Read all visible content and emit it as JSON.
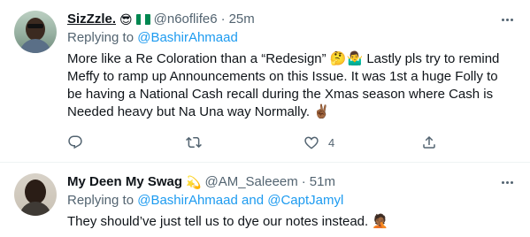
{
  "tweets": [
    {
      "name": "SizZzle.",
      "name_emoji": "😎",
      "flag_colors": [
        "#008751",
        "#ffffff",
        "#008751"
      ],
      "handle": "@n6oflife6",
      "separator": "·",
      "time": "25m",
      "replying_prefix": "Replying to ",
      "replying_to": [
        "@BashirAhmaad"
      ],
      "text": "More like a Re Coloration than a “Redesign” 🤔🤷‍♂️ Lastly pls try to remind Meffy to ramp up Announcements on this Issue. It was 1st a huge Folly to be having a National Cash recall during the Xmas season where Cash is Needed heavy but Na Una way Normally. ✌🏾",
      "actions": {
        "reply_count": "",
        "retweet_count": "",
        "like_count": "4"
      }
    },
    {
      "name": "My Deen My Swag",
      "name_emoji": "💫",
      "handle": "@AM_Saleeem",
      "separator": "·",
      "time": "51m",
      "replying_prefix": "Replying to ",
      "replying_to": [
        "@BashirAhmaad",
        "@CaptJamyl"
      ],
      "replying_join": " and ",
      "text": "They should’ve just tell us to dye our notes instead. 🤦🏾"
    }
  ],
  "colors": {
    "text": "#0f1419",
    "secondary": "#536471",
    "accent": "#1d9bf0",
    "divider": "#eff3f4"
  },
  "icons": [
    "more-icon",
    "reply-icon",
    "retweet-icon",
    "like-icon",
    "share-icon"
  ]
}
